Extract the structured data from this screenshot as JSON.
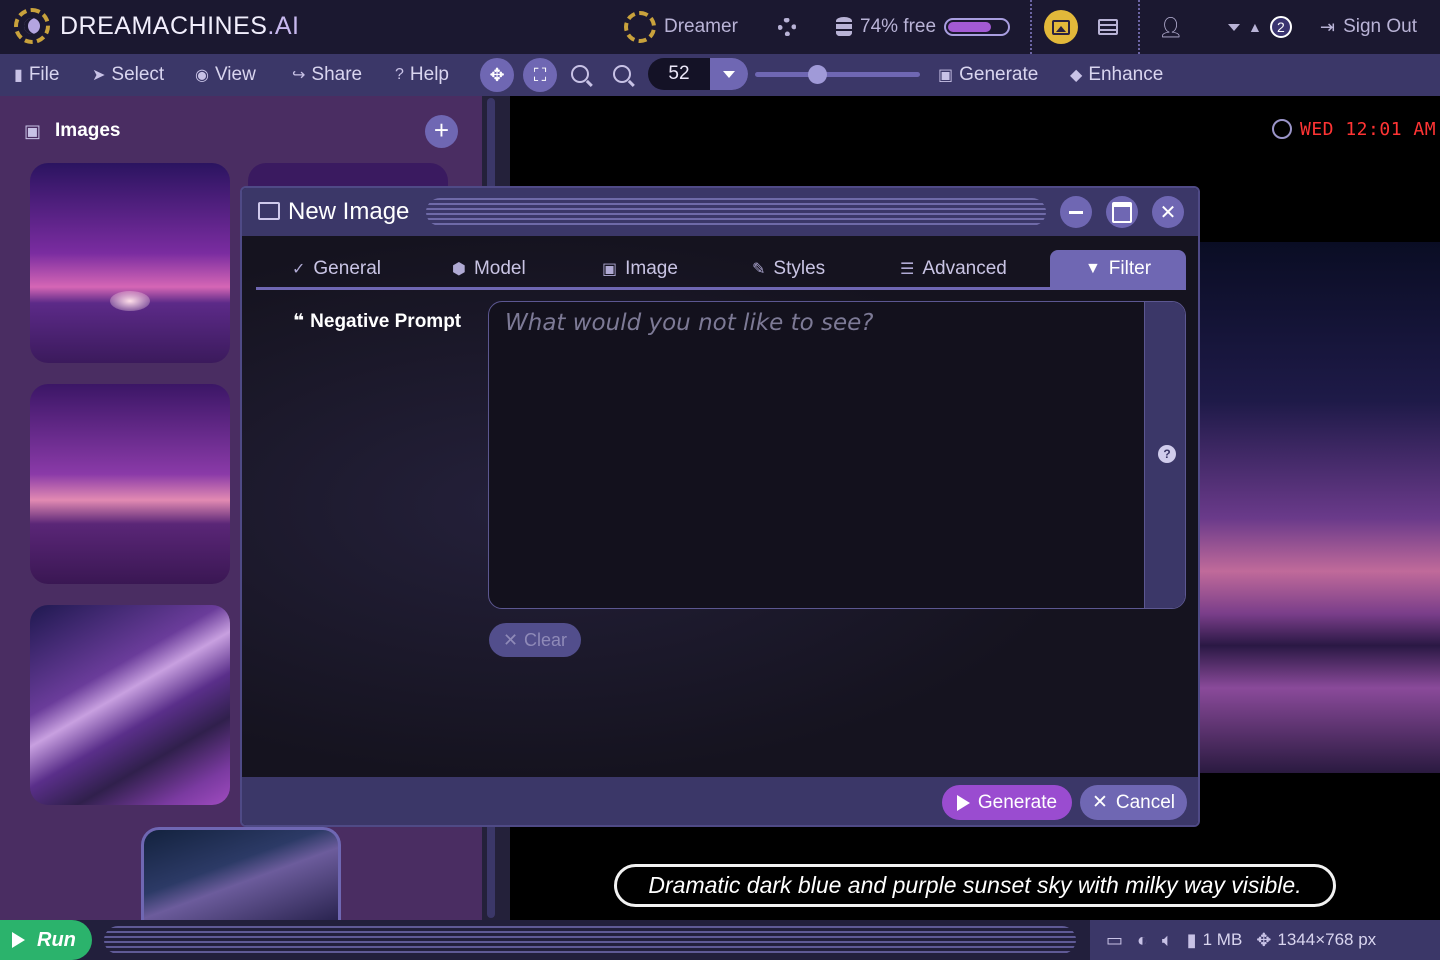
{
  "app": {
    "logo_main": "DREAMACHINES",
    "logo_ai": ".AI"
  },
  "header": {
    "profile": "Dreamer",
    "memory_text": "74% free",
    "memory_fraction": 0.74,
    "notification_count": "2",
    "sign_out": "Sign Out"
  },
  "menu": {
    "file": "File",
    "select": "Select",
    "view": "View",
    "share": "Share",
    "help": "Help",
    "zoom_value": "52",
    "generate": "Generate",
    "enhance": "Enhance",
    "clock": "WED 12:01 AM"
  },
  "sidebar": {
    "title": "Images"
  },
  "dialog": {
    "title": "New Image",
    "tabs": [
      {
        "label": "General",
        "icon": "check-icon"
      },
      {
        "label": "Model",
        "icon": "cube-icon"
      },
      {
        "label": "Image",
        "icon": "image-icon"
      },
      {
        "label": "Styles",
        "icon": "brush-icon"
      },
      {
        "label": "Advanced",
        "icon": "sliders-icon"
      },
      {
        "label": "Filter",
        "icon": "filter-icon"
      }
    ],
    "active_tab": "Filter",
    "negative_prompt_label": "Negative Prompt",
    "negative_prompt_placeholder": "What would you not like to see?",
    "negative_prompt_value": "",
    "clear_label": "Clear",
    "generate_label": "Generate",
    "cancel_label": "Cancel"
  },
  "canvas": {
    "caption": "Dramatic dark blue and purple sunset sky with milky way visible."
  },
  "statusbar": {
    "run_label": "Run",
    "file_size": "1 MB",
    "dimensions": "1344×768 px"
  },
  "colors": {
    "accent": "#6f67b3",
    "generate": "#9a4cd0",
    "run": "#2bb36c",
    "clock": "#ff3434",
    "toolbar": "#3b3768"
  }
}
